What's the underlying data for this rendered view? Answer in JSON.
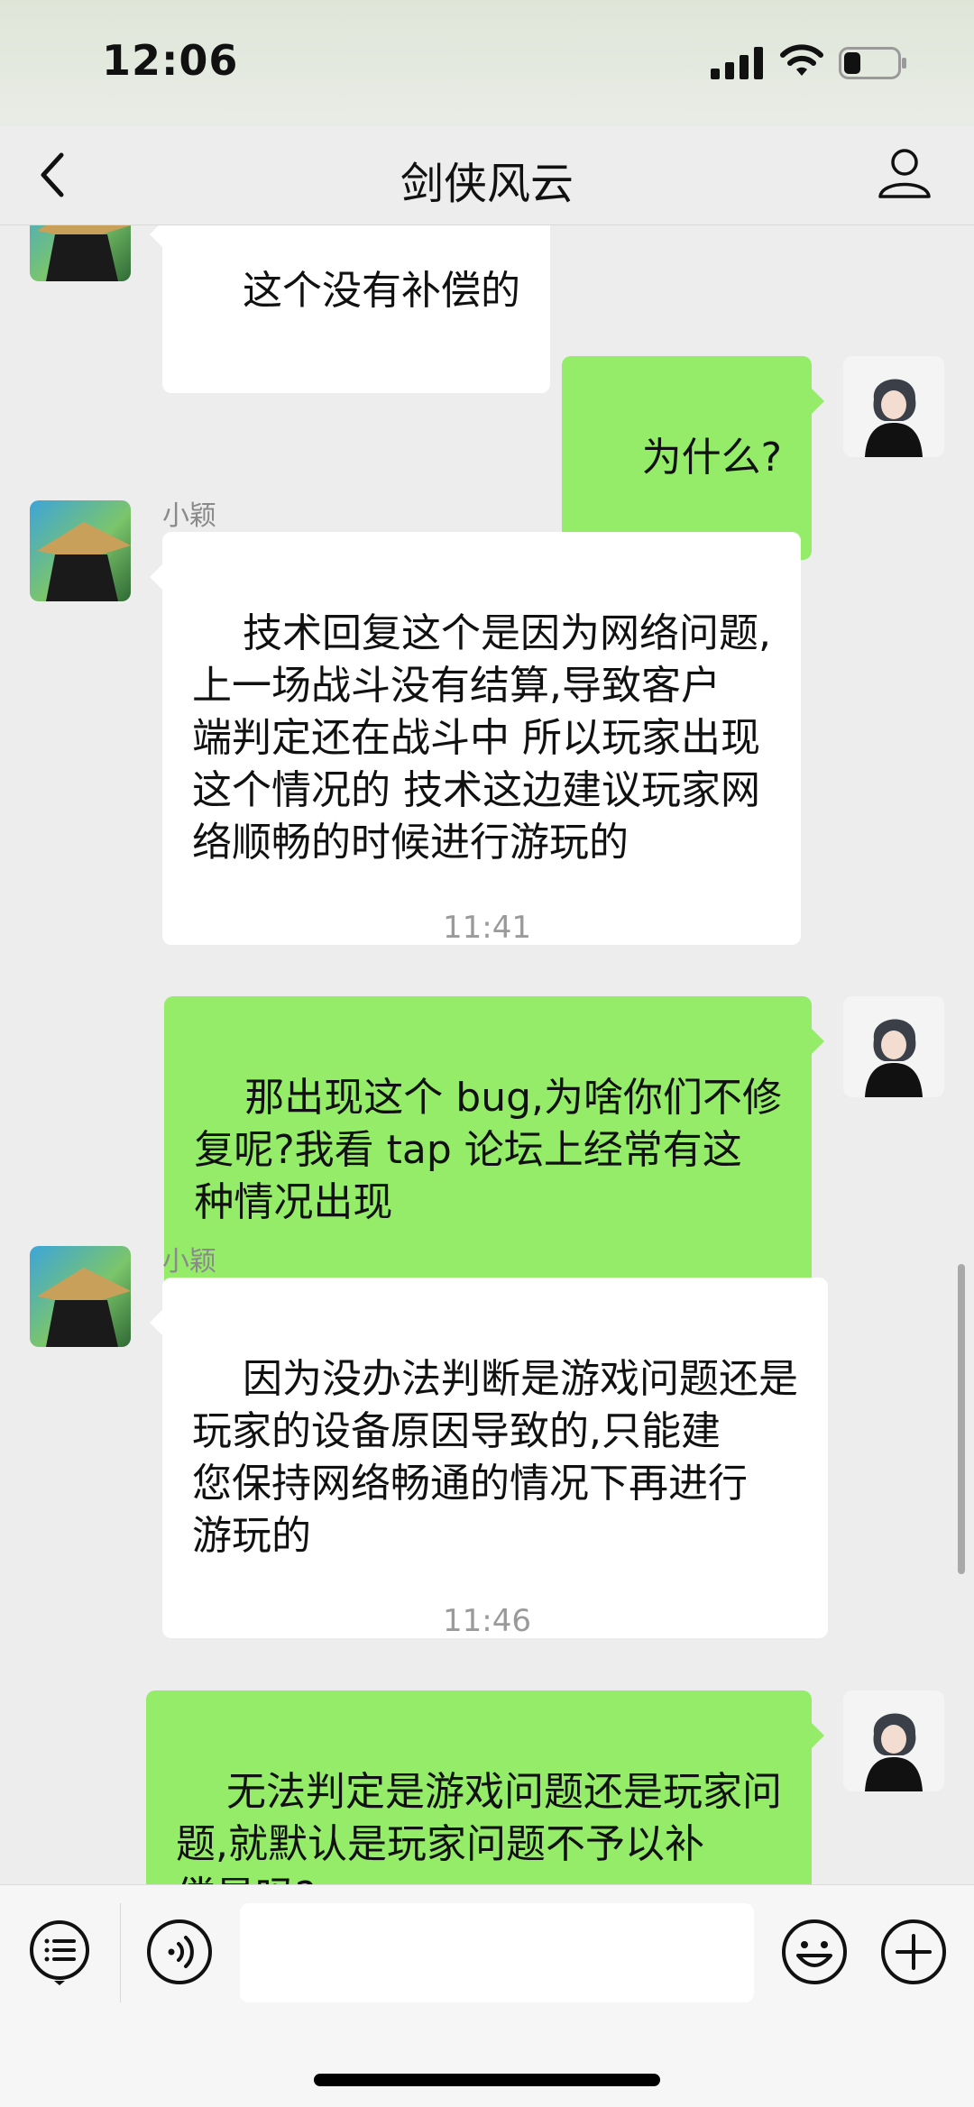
{
  "status_bar": {
    "time": "12:06",
    "signal_icon": "cellular-signal-icon",
    "wifi_icon": "wifi-icon",
    "battery_icon": "battery-icon"
  },
  "header": {
    "title": "剑侠风云",
    "back_icon": "chevron-left-icon",
    "profile_icon": "person-icon"
  },
  "messages": [
    {
      "side": "left",
      "sender": "",
      "text": "这个没有补偿的"
    },
    {
      "side": "right",
      "text": "为什么?"
    },
    {
      "side": "left",
      "sender": "小颖",
      "text": "技术回复这个是因为网络问题,\n上一场战斗没有结算,导致客户\n端判定还在战斗中 所以玩家出现\n这个情况的 技术这边建议玩家网\n络顺畅的时候进行游玩的"
    },
    {
      "type": "time",
      "text": "11:41"
    },
    {
      "side": "right",
      "text": "那出现这个 bug,为啥你们不修\n复呢?我看 tap 论坛上经常有这\n种情况出现"
    },
    {
      "side": "left",
      "sender": "小颖",
      "text": "因为没办法判断是游戏问题还是\n玩家的设备原因导致的,只能建\n您保持网络畅通的情况下再进行\n游玩的"
    },
    {
      "type": "time",
      "text": "11:46"
    },
    {
      "side": "right",
      "text": "无法判定是游戏问题还是玩家问\n题,就默认是玩家问题不予以补\n偿是吗?"
    }
  ],
  "input_bar": {
    "menu_icon": "list-menu-icon",
    "voice_icon": "voice-icon",
    "emoji_icon": "emoji-icon",
    "plus_icon": "plus-icon",
    "placeholder": ""
  },
  "colors": {
    "background": "#ededed",
    "my_bubble": "#95ec69",
    "other_bubble": "#ffffff"
  }
}
